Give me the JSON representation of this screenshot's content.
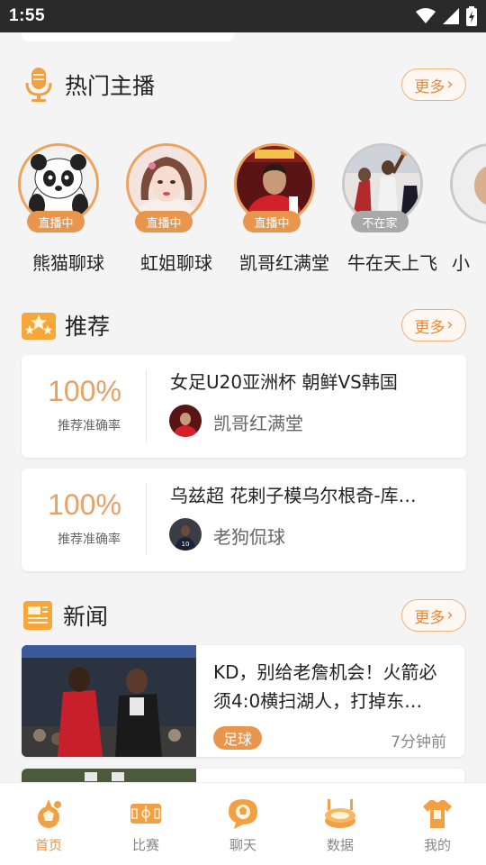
{
  "status_bar": {
    "time": "1:55"
  },
  "sections": {
    "hot_streamers": {
      "title": "热门主播",
      "more": "更多"
    },
    "recommend": {
      "title": "推荐",
      "more": "更多"
    },
    "news": {
      "title": "新闻",
      "more": "更多"
    }
  },
  "streamers": [
    {
      "name": "熊猫聊球",
      "status": "直播中",
      "live": true
    },
    {
      "name": "虹姐聊球",
      "status": "直播中",
      "live": true
    },
    {
      "name": "凯哥红满堂",
      "status": "直播中",
      "live": true
    },
    {
      "name": "牛在天上飞",
      "status": "不在家",
      "live": false
    },
    {
      "name": "小",
      "status": "",
      "live": false
    }
  ],
  "recommendations": [
    {
      "rate": "100%",
      "rate_label": "推荐准确率",
      "title": "女足U20亚洲杯 朝鲜VS韩国",
      "author": "凯哥红满堂"
    },
    {
      "rate": "100%",
      "rate_label": "推荐准确率",
      "title": "乌兹超 花剌子模乌尔根奇-库…",
      "author": "老狗侃球"
    }
  ],
  "news": [
    {
      "title": "KD，别给老詹机会！火箭必须4:0横扫湖人，打掉东…",
      "tag": "足球",
      "time": "7分钟前"
    }
  ],
  "tabs": [
    {
      "label": "首页",
      "icon": "home-football-icon",
      "active": true
    },
    {
      "label": "比赛",
      "icon": "match-pitch-icon",
      "active": false
    },
    {
      "label": "聊天",
      "icon": "chat-bubble-icon",
      "active": false
    },
    {
      "label": "数据",
      "icon": "stadium-data-icon",
      "active": false
    },
    {
      "label": "我的",
      "icon": "jersey-profile-icon",
      "active": false
    }
  ],
  "colors": {
    "accent": "#e8964e",
    "accent_light": "#f0b07a",
    "offline": "#a9a9a9"
  }
}
